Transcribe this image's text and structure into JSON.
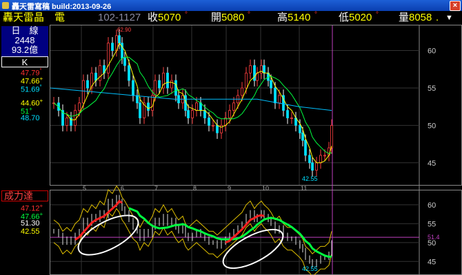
{
  "window": {
    "title": "轟天雷寫稿 build:2013-09-26",
    "close_label": "×"
  },
  "infobar": {
    "stock_name": "轟天雷晶　電",
    "code": "102-1127",
    "close_label": "收",
    "close_value": "5070",
    "close_suffix": "°",
    "open_label": "開",
    "open_value": "5080",
    "open_suffix": "°",
    "high_label": "高",
    "high_value": "5140",
    "high_suffix": "°",
    "low_label": "低",
    "low_value": "5020",
    "low_suffix": "°",
    "vol_label": "量",
    "vol_value": "8058",
    "vol_suffix": ".",
    "arrow": "▼"
  },
  "left_panel": {
    "period": "日　線",
    "count": "2448",
    "amount": "93.2億",
    "mode": "K",
    "k_values": [
      {
        "text": "47.79",
        "suffix": "°",
        "color": "#ff3030"
      },
      {
        "text": "47.66",
        "suffix": "+",
        "color": "#ffff00"
      },
      {
        "text": "51.69",
        "suffix": "°",
        "color": "#00e0ff"
      },
      {
        "text": "44.60",
        "suffix": "+",
        "color": "#ffff00"
      },
      {
        "text": "51",
        "suffix": "+",
        "color": "#00ff40"
      },
      {
        "text": "48.70",
        "suffix": "",
        "color": "#00e0ff"
      }
    ],
    "ind2_title": "成力達",
    "ind2_values": [
      {
        "text": "47.12",
        "suffix": "+",
        "color": "#ff3030"
      },
      {
        "text": "47.66",
        "suffix": "+",
        "color": "#00ff40"
      },
      {
        "text": "51.30",
        "suffix": "",
        "color": "#ffffff"
      },
      {
        "text": "42.55",
        "suffix": "",
        "color": "#ffff00"
      }
    ]
  },
  "top_chart": {
    "y_ticks": [
      "60",
      "55",
      "50",
      "45"
    ],
    "x_labels": [
      "5",
      "6",
      "7",
      "8",
      "9",
      "10",
      "11"
    ],
    "high_label": "62.90",
    "low_label": "42.55"
  },
  "bottom_chart": {
    "y_ticks": [
      "60",
      "55",
      "50",
      "45"
    ],
    "ref_label": "51.4",
    "low_label": "42.55"
  }
}
